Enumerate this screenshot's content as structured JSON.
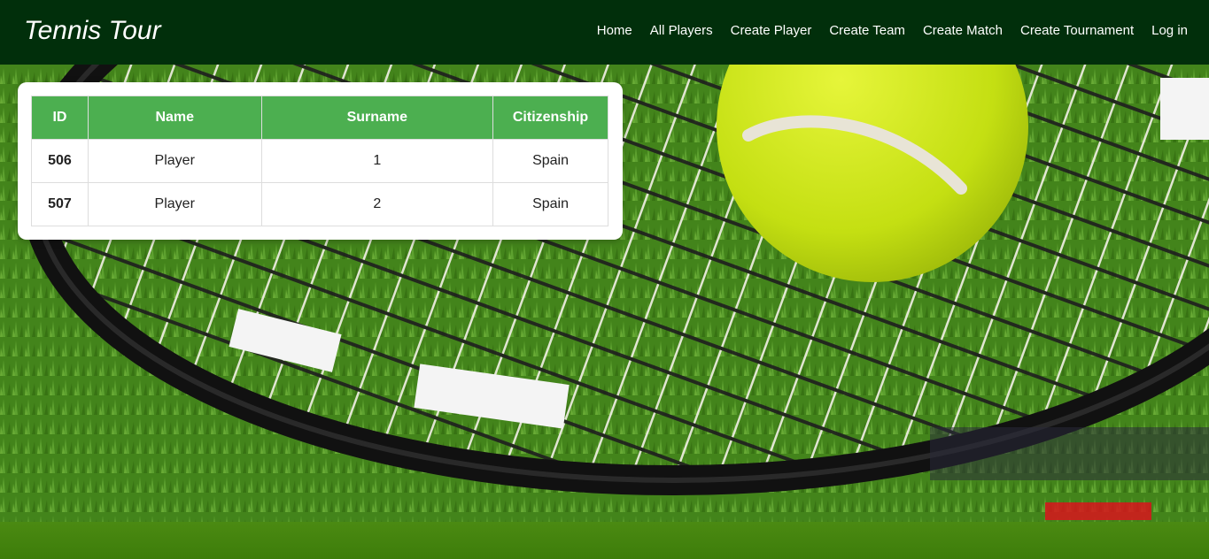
{
  "header": {
    "brand": "Tennis Tour",
    "nav": [
      "Home",
      "All Players",
      "Create Player",
      "Create Team",
      "Create Match",
      "Create Tournament",
      "Log in"
    ]
  },
  "table": {
    "headers": [
      "ID",
      "Name",
      "Surname",
      "Citizenship"
    ],
    "rows": [
      [
        "506",
        "Player",
        "1",
        "Spain"
      ],
      [
        "507",
        "Player",
        "2",
        "Spain"
      ]
    ]
  },
  "colors": {
    "header_bg": "#012f0b",
    "table_header_bg": "#4caf50",
    "grass": "#4a8c1f",
    "ball": "#c9e81a"
  }
}
